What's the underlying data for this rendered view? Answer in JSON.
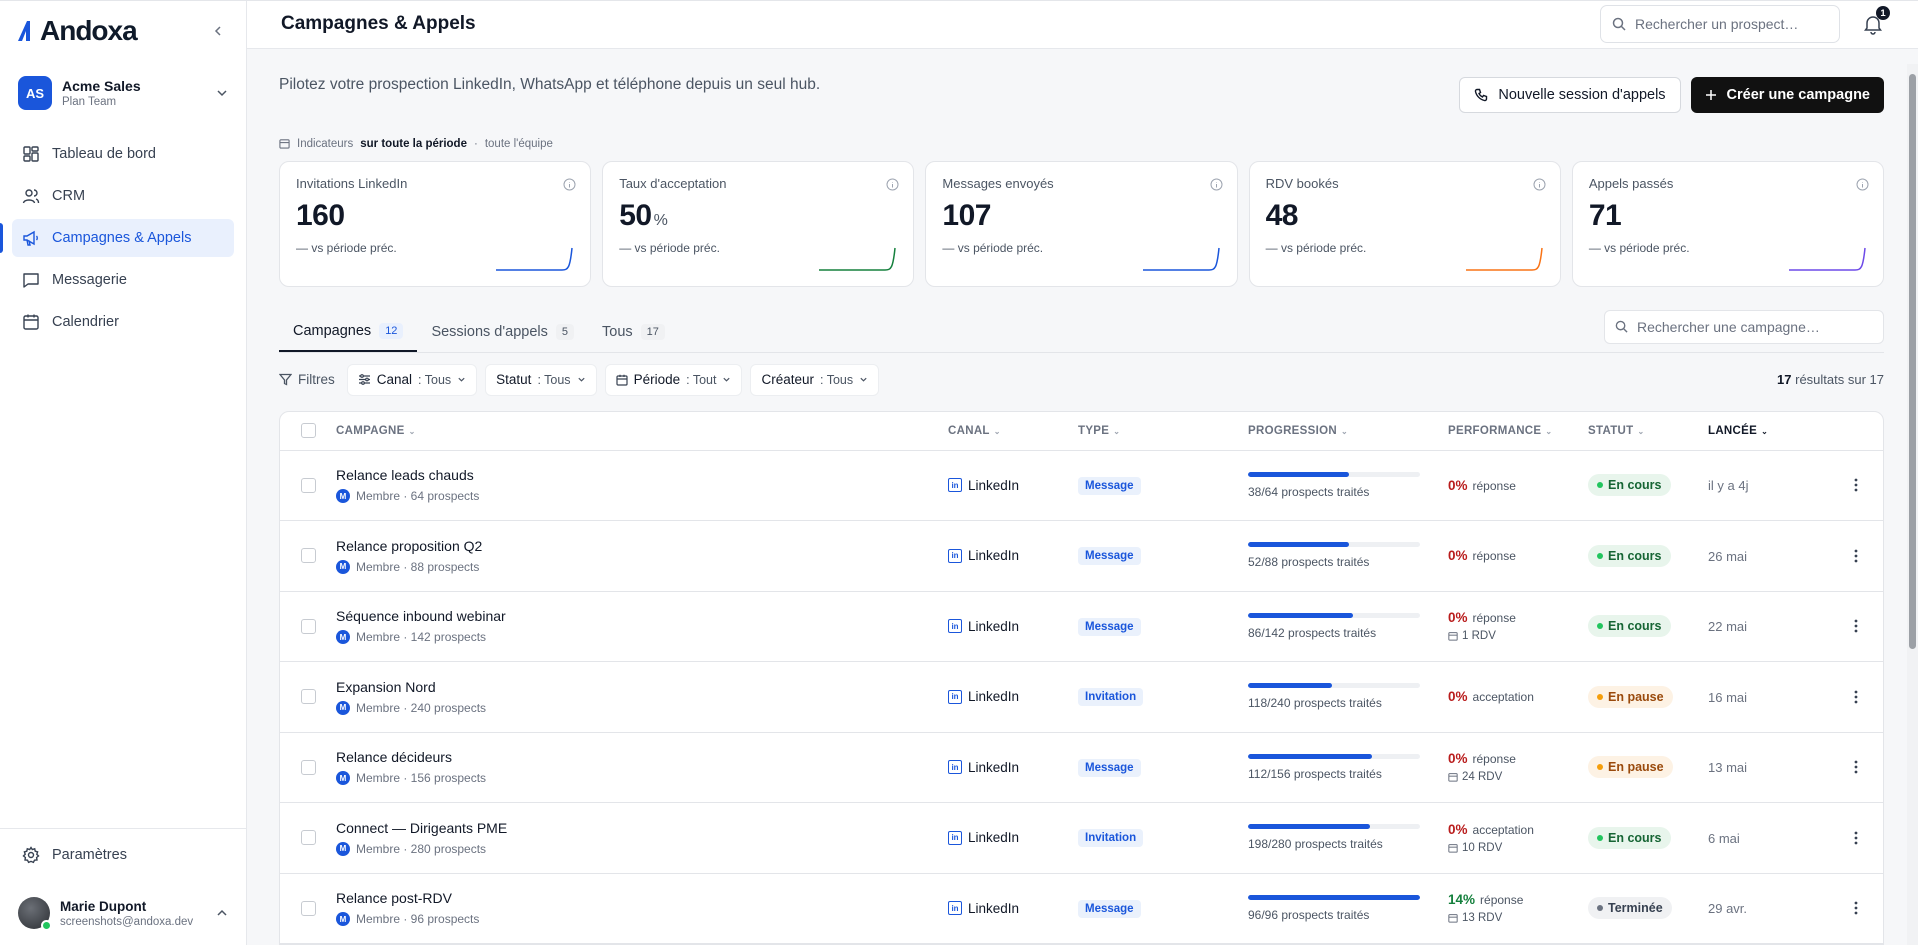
{
  "brand": {
    "name": "Andoxa"
  },
  "workspace": {
    "initials": "AS",
    "name": "Acme Sales",
    "plan": "Plan Team"
  },
  "nav": [
    {
      "label": "Tableau de bord",
      "icon": "dashboard-icon"
    },
    {
      "label": "CRM",
      "icon": "users-icon"
    },
    {
      "label": "Campagnes & Appels",
      "icon": "megaphone-icon",
      "active": true
    },
    {
      "label": "Messagerie",
      "icon": "message-icon"
    },
    {
      "label": "Calendrier",
      "icon": "calendar-icon"
    }
  ],
  "settings": {
    "label": "Paramètres"
  },
  "user": {
    "name": "Marie Dupont",
    "email": "screenshots@andoxa.dev"
  },
  "header": {
    "title": "Campagnes & Appels",
    "search_placeholder": "Rechercher un prospect…",
    "notifications": "1"
  },
  "hero": {
    "text": "Pilotez votre prospection LinkedIn, WhatsApp et téléphone depuis un seul hub.",
    "btn_calls": "Nouvelle session d'appels",
    "btn_create": "Créer une campagne"
  },
  "indicators": {
    "label": "Indicateurs",
    "period": "sur toute la période",
    "sep": "·",
    "scope": "toute l'équipe"
  },
  "kpis": [
    {
      "label": "Invitations LinkedIn",
      "value": "160",
      "unit": "",
      "delta": "— vs période préc.",
      "color": "#1a56db"
    },
    {
      "label": "Taux d'acceptation",
      "value": "50",
      "unit": "%",
      "delta": "— vs période préc.",
      "color": "#15803d"
    },
    {
      "label": "Messages envoyés",
      "value": "107",
      "unit": "",
      "delta": "— vs période préc.",
      "color": "#1a56db"
    },
    {
      "label": "RDV bookés",
      "value": "48",
      "unit": "",
      "delta": "— vs période préc.",
      "color": "#f97316"
    },
    {
      "label": "Appels passés",
      "value": "71",
      "unit": "",
      "delta": "— vs période préc.",
      "color": "#6d4ae8"
    }
  ],
  "tabs": [
    {
      "label": "Campagnes",
      "count": "12",
      "active": true
    },
    {
      "label": "Sessions d'appels",
      "count": "5"
    },
    {
      "label": "Tous",
      "count": "17"
    }
  ],
  "campaign_search_placeholder": "Rechercher une campagne…",
  "filters": {
    "label": "Filtres",
    "chips": [
      {
        "name": "Canal",
        "value": ": Tous"
      },
      {
        "name": "Statut",
        "value": ": Tous"
      },
      {
        "name": "Période",
        "value": ": Tout"
      },
      {
        "name": "Créateur",
        "value": ": Tous"
      }
    ],
    "results_count": "17",
    "results_text": "résultats sur 17"
  },
  "table": {
    "headers": {
      "campaign": "CAMPAGNE",
      "canal": "CANAL",
      "type": "TYPE",
      "progress": "PROGRESSION",
      "performance": "PERFORMANCE",
      "status": "STATUT",
      "launched": "LANCÉE"
    },
    "rows": [
      {
        "name": "Relance leads chauds",
        "meta": "Membre · 64 prospects",
        "canal": "LinkedIn",
        "type": "Message",
        "progress": 0.59,
        "progress_text": "38/64 prospects traités",
        "perf_pct": "0%",
        "perf_label": "réponse",
        "perf_rdv": "",
        "status": "En cours",
        "status_kind": "running",
        "date": "il y a 4j"
      },
      {
        "name": "Relance proposition Q2",
        "meta": "Membre · 88 prospects",
        "canal": "LinkedIn",
        "type": "Message",
        "progress": 0.59,
        "progress_text": "52/88 prospects traités",
        "perf_pct": "0%",
        "perf_label": "réponse",
        "perf_rdv": "",
        "status": "En cours",
        "status_kind": "running",
        "date": "26 mai"
      },
      {
        "name": "Séquence inbound webinar",
        "meta": "Membre · 142 prospects",
        "canal": "LinkedIn",
        "type": "Message",
        "progress": 0.61,
        "progress_text": "86/142 prospects traités",
        "perf_pct": "0%",
        "perf_label": "réponse",
        "perf_rdv": "1 RDV",
        "status": "En cours",
        "status_kind": "running",
        "date": "22 mai"
      },
      {
        "name": "Expansion Nord",
        "meta": "Membre · 240 prospects",
        "canal": "LinkedIn",
        "type": "Invitation",
        "progress": 0.49,
        "progress_text": "118/240 prospects traités",
        "perf_pct": "0%",
        "perf_label": "acceptation",
        "perf_rdv": "",
        "status": "En pause",
        "status_kind": "paused",
        "date": "16 mai"
      },
      {
        "name": "Relance décideurs",
        "meta": "Membre · 156 prospects",
        "canal": "LinkedIn",
        "type": "Message",
        "progress": 0.72,
        "progress_text": "112/156 prospects traités",
        "perf_pct": "0%",
        "perf_label": "réponse",
        "perf_rdv": "24 RDV",
        "status": "En pause",
        "status_kind": "paused",
        "date": "13 mai"
      },
      {
        "name": "Connect — Dirigeants PME",
        "meta": "Membre · 280 prospects",
        "canal": "LinkedIn",
        "type": "Invitation",
        "progress": 0.71,
        "progress_text": "198/280 prospects traités",
        "perf_pct": "0%",
        "perf_label": "acceptation",
        "perf_rdv": "10 RDV",
        "status": "En cours",
        "status_kind": "running",
        "date": "6 mai"
      },
      {
        "name": "Relance post-RDV",
        "meta": "Membre · 96 prospects",
        "canal": "LinkedIn",
        "type": "Message",
        "progress": 1.0,
        "progress_text": "96/96 prospects traités",
        "perf_pct": "14%",
        "perf_label": "réponse",
        "perf_rdv": "13 RDV",
        "status": "Terminée",
        "status_kind": "done",
        "date": "29 avr."
      }
    ]
  }
}
